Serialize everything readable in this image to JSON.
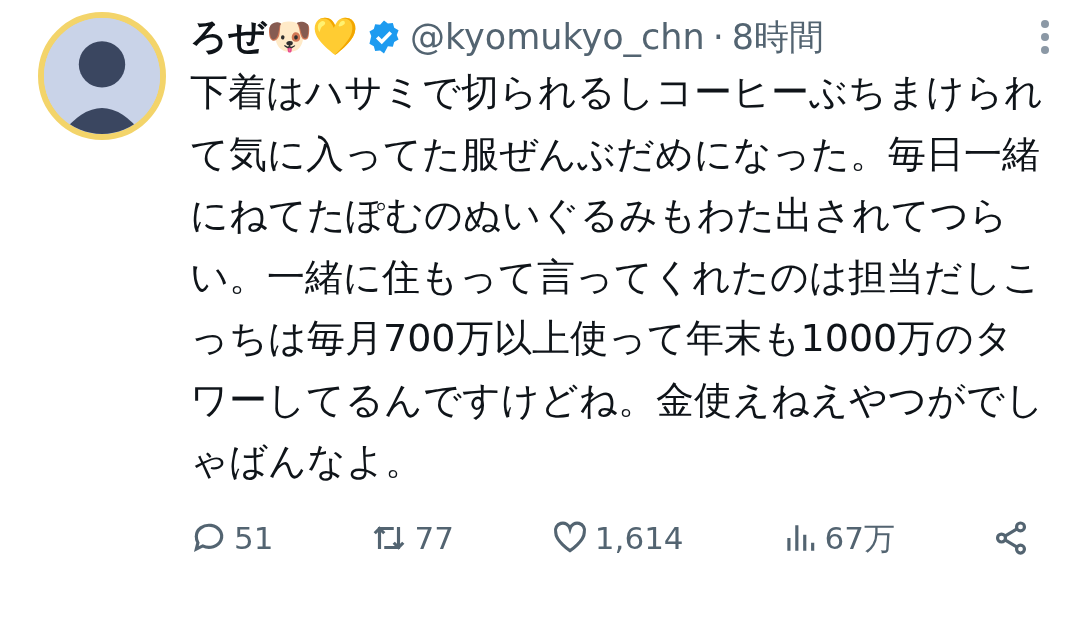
{
  "author": {
    "name": "ろぜ🐶💛",
    "verified": true,
    "handle": "@kyomukyo_chn",
    "separator": "·",
    "time": "8時間"
  },
  "text": "下着はハサミで切られるしコーヒーぶちまけられて気に入ってた服ぜんぶだめになった。毎日一緒にねてたぽむのぬいぐるみもわた出されてつらい。一緒に住もって言ってくれたのは担当だしこっちは毎月700万以上使って年末も1000万のタワーしてるんですけどね。金使えねえやつがでしゃばんなよ。",
  "actions": [
    {
      "kind": "reply",
      "count": "51"
    },
    {
      "kind": "retweet",
      "count": "77"
    },
    {
      "kind": "like",
      "count": "1,614"
    },
    {
      "kind": "views",
      "count": "67万"
    },
    {
      "kind": "share"
    }
  ]
}
